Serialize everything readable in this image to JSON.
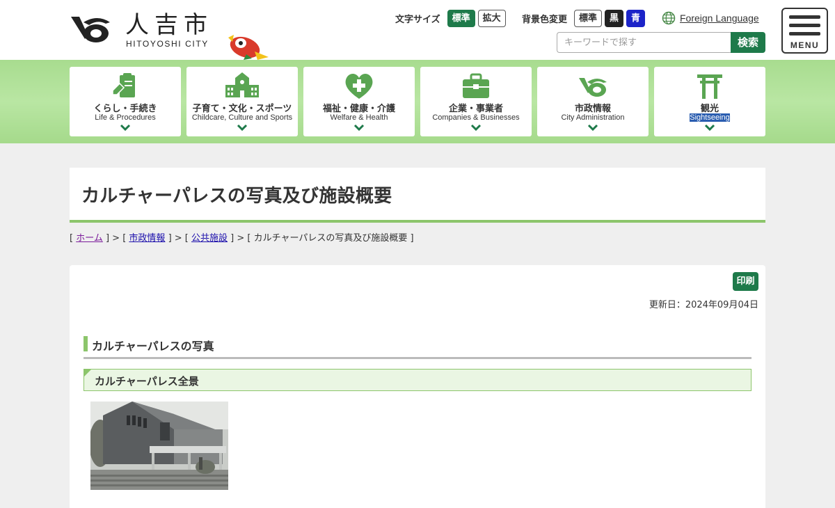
{
  "header": {
    "logo_jp": "人吉市",
    "logo_en": "HITOYOSHI CITY",
    "font_size_label": "文字サイズ",
    "font_size_options": [
      "標準",
      "拡大"
    ],
    "bg_color_label": "背景色変更",
    "bg_color_options": [
      "標準",
      "黒",
      "青"
    ],
    "language_link": "Foreign Language",
    "search_placeholder": "キーワードで探す",
    "search_button": "検索",
    "menu_label": "MENU"
  },
  "nav": [
    {
      "jp": "くらし・手続き",
      "en": "Life & Procedures",
      "icon": "clipboard-icon"
    },
    {
      "jp": "子育て・文化・スポーツ",
      "en": "Childcare, Culture and Sports",
      "icon": "school-icon"
    },
    {
      "jp": "福祉・健康・介護",
      "en": "Welfare & Health",
      "icon": "heart-cross-icon"
    },
    {
      "jp": "企業・事業者",
      "en": "Companies & Businesses",
      "icon": "briefcase-icon"
    },
    {
      "jp": "市政情報",
      "en": "City Administration",
      "icon": "city-emblem-icon"
    },
    {
      "jp": "観光",
      "en": "Sightseeing",
      "icon": "torii-gate-icon"
    }
  ],
  "page": {
    "title": "カルチャーパレスの写真及び施設概要",
    "breadcrumb": {
      "home": "ホーム",
      "item1": "市政情報",
      "item2": "公共施設",
      "current": "カルチャーパレスの写真及び施設概要"
    },
    "print_button": "印刷",
    "updated": "更新日：2024年09月04日",
    "section_heading": "カルチャーパレスの写真",
    "subsection_heading": "カルチャーパレス全景"
  },
  "colors": {
    "accent_green": "#1e7a4a",
    "light_green": "#8cc56b",
    "nav_icon_green": "#5aa552"
  }
}
